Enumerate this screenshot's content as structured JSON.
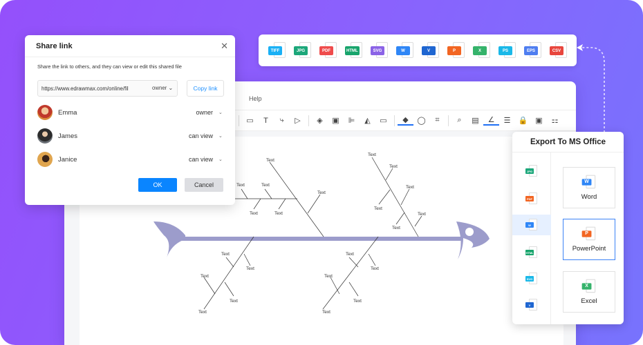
{
  "export_formats": [
    {
      "label": "TIFF",
      "color": "#1ab0f5",
      "icon": "tiff-file-icon"
    },
    {
      "label": "JPG",
      "color": "#1ca77a",
      "icon": "jpg-file-icon"
    },
    {
      "label": "PDF",
      "color": "#ef4c4c",
      "icon": "pdf-file-icon"
    },
    {
      "label": "HTML",
      "color": "#18a46c",
      "icon": "html-file-icon"
    },
    {
      "label": "SVG",
      "color": "#8b63e6",
      "icon": "svg-file-icon"
    },
    {
      "label": "W",
      "color": "#2f86f6",
      "icon": "word-file-icon"
    },
    {
      "label": "V",
      "color": "#1f66d1",
      "icon": "visio-file-icon"
    },
    {
      "label": "P",
      "color": "#f26522",
      "icon": "powerpoint-file-icon"
    },
    {
      "label": "X",
      "color": "#35b36b",
      "icon": "excel-file-icon"
    },
    {
      "label": "PS",
      "color": "#1ab8e8",
      "icon": "ps-file-icon"
    },
    {
      "label": "EPS",
      "color": "#4f7ef0",
      "icon": "eps-file-icon"
    },
    {
      "label": "CSV",
      "color": "#e8463d",
      "icon": "csv-file-icon"
    }
  ],
  "editor": {
    "menu_help": "Help",
    "toolbar_icons": [
      "rectangle-icon",
      "text-icon",
      "connector-icon",
      "pointer-icon",
      "layers-icon",
      "group-icon",
      "align-icon",
      "flip-icon",
      "frame-icon",
      "fill-color-icon",
      "shape-style-icon",
      "crop-icon",
      "search-icon",
      "format-painter-icon",
      "line-color-icon",
      "line-style-icon",
      "lock-icon",
      "fit-icon",
      "more-icon"
    ],
    "toolbar_glyphs": [
      "▭",
      "T",
      "⤷",
      "▷",
      "◈",
      "▣",
      "⊫",
      "◭",
      "▭",
      "◆",
      "◯",
      "⌗",
      "⌕",
      "▤",
      "∠",
      "☰",
      "🔒",
      "▣",
      "⚏"
    ]
  },
  "fishbone": {
    "label": "Text",
    "head_color": "#9c9ccb",
    "spine_color": "#9c9ccb"
  },
  "share_dialog": {
    "title": "Share link",
    "description": "Share the link to others, and they can view or edit this shared file",
    "url": "https://www.edrawmax.com/online/fil",
    "url_role": "owner",
    "copy_label": "Copy link",
    "users": [
      {
        "name": "Emma",
        "role": "owner",
        "avatar_color": "#d88a3a"
      },
      {
        "name": "James",
        "role": "can view",
        "avatar_color": "#4a4f55"
      },
      {
        "name": "Janice",
        "role": "can view",
        "avatar_color": "#c98a3c"
      }
    ],
    "ok_label": "OK",
    "cancel_label": "Cancel"
  },
  "ms_office_panel": {
    "title": "Export To MS Office",
    "left_formats": [
      {
        "label": "JPG",
        "color": "#1ca77a",
        "active": false
      },
      {
        "label": "PDF",
        "color": "#f26522",
        "active": false
      },
      {
        "label": "W",
        "color": "#2f86f6",
        "active": true
      },
      {
        "label": "HTML",
        "color": "#18a46c",
        "active": false
      },
      {
        "label": "SVG",
        "color": "#1ab8e8",
        "active": false
      },
      {
        "label": "V",
        "color": "#1f66d1",
        "active": false
      }
    ],
    "options": [
      {
        "label": "Word",
        "tag": "W",
        "color": "#2f86f6",
        "selected": false
      },
      {
        "label": "PowerPoint",
        "tag": "P",
        "color": "#f26522",
        "selected": true
      },
      {
        "label": "Excel",
        "tag": "X",
        "color": "#35b36b",
        "selected": false
      }
    ]
  }
}
